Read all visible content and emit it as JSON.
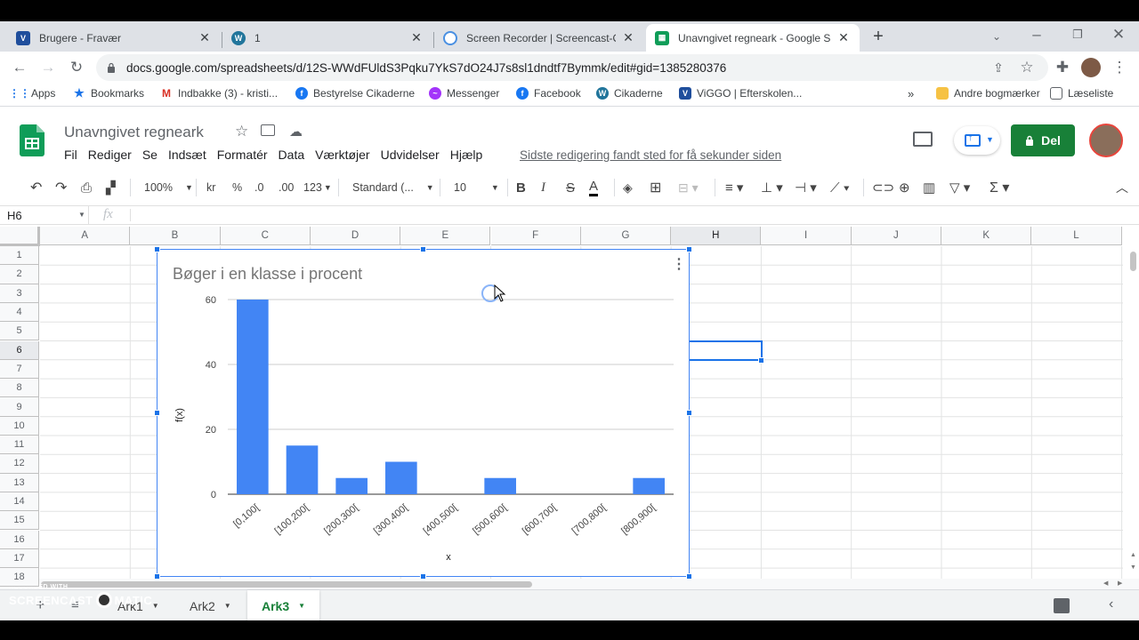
{
  "browser": {
    "tabs": [
      {
        "title": "Brugere - Fravær",
        "favicon": "viggo-icon",
        "active": false
      },
      {
        "title": "1",
        "favicon": "wordpress-icon",
        "active": false
      },
      {
        "title": "Screen Recorder | Screencast-O-M",
        "favicon": "screencast-icon",
        "active": false
      },
      {
        "title": "Unavngivet regneark - Google Sh",
        "favicon": "sheets-icon",
        "active": true
      }
    ],
    "url": "docs.google.com/spreadsheets/d/12S-WWdFUldS3Pqku7YkS7dO24J7s8sl1dndtf7Bymmk/edit#gid=1385280376",
    "bookmarks": [
      {
        "label": "Apps",
        "icon": "apps-grid-icon"
      },
      {
        "label": "Bookmarks",
        "icon": "star-icon"
      },
      {
        "label": "Indbakke (3) - kristi...",
        "icon": "gmail-icon"
      },
      {
        "label": "Bestyrelse Cikaderne",
        "icon": "facebook-icon"
      },
      {
        "label": "Messenger",
        "icon": "messenger-icon"
      },
      {
        "label": "Facebook",
        "icon": "facebook-icon"
      },
      {
        "label": "Cikaderne",
        "icon": "wordpress-icon"
      },
      {
        "label": "ViGGO | Efterskolen...",
        "icon": "viggo-icon"
      }
    ],
    "bookmarks_more": "»",
    "other_bookmarks": "Andre bogmærker",
    "reading_list": "Læseliste"
  },
  "sheets": {
    "title": "Unavngivet regneark",
    "menu": [
      "Fil",
      "Rediger",
      "Se",
      "Indsæt",
      "Formatér",
      "Data",
      "Værktøjer",
      "Udvidelser",
      "Hjælp"
    ],
    "last_edit": "Sidste redigering fandt sted for få sekunder siden",
    "share_label": "Del",
    "toolbar": {
      "zoom": "100%",
      "currency": "kr",
      "percent": "%",
      "dec_less": ".0",
      "dec_more": ".00",
      "more_formats": "123",
      "font": "Standard (...",
      "font_size": "10"
    },
    "name_box": "H6",
    "fx": "fx",
    "columns": [
      "A",
      "B",
      "C",
      "D",
      "E",
      "F",
      "G",
      "H",
      "I",
      "J",
      "K",
      "L"
    ],
    "rows": [
      "1",
      "2",
      "3",
      "4",
      "5",
      "6",
      "7",
      "8",
      "9",
      "10",
      "11",
      "12",
      "13",
      "14",
      "15",
      "16",
      "17",
      "18"
    ],
    "sheet_tabs": [
      {
        "label": "Ark1",
        "active": false
      },
      {
        "label": "Ark2",
        "active": false
      },
      {
        "label": "Ark3",
        "active": true
      }
    ]
  },
  "watermark": {
    "line1": "RECORDED WITH",
    "line2": "SCREENCAST",
    "line3": "MATIC"
  },
  "colors": {
    "accent": "#1a73e8",
    "bar": "#4285f4",
    "share": "#188038"
  },
  "chart_data": {
    "type": "bar",
    "title": "Bøger i en klasse i procent",
    "xlabel": "x",
    "ylabel": "f(x)",
    "categories": [
      "[0,100[",
      "[100,200[",
      "[200,300[",
      "[300,400[",
      "[400,500[",
      "[500,600[",
      "[600,700[",
      "[700,800[",
      "[800,900["
    ],
    "values": [
      60,
      15,
      5,
      10,
      0,
      5,
      0,
      0,
      5
    ],
    "ylim": [
      0,
      60
    ],
    "yticks": [
      "0",
      "20",
      "40",
      "60"
    ],
    "grid": true,
    "color": "#4285f4"
  }
}
